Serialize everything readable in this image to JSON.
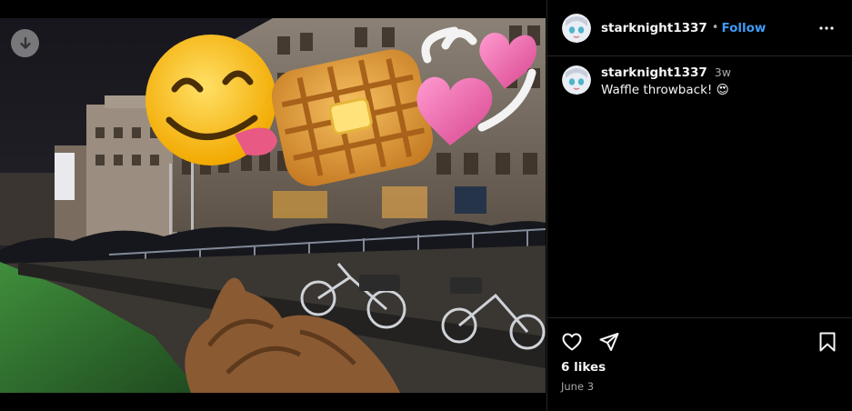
{
  "post": {
    "username": "starknight1337",
    "separator": "•",
    "follow_label": "Follow",
    "caption_time": "3w",
    "caption_text": "Waffle throwback! 😍",
    "likes_label": "6 likes",
    "date_label": "June 3"
  },
  "icons": {
    "download": "download-icon",
    "more": "more-options-icon",
    "like": "heart-icon",
    "share": "send-icon",
    "save": "bookmark-icon"
  },
  "colors": {
    "accent": "#3f9bf5",
    "background": "#000000",
    "secondary_text": "#a8a8a8",
    "divider": "#262626"
  }
}
